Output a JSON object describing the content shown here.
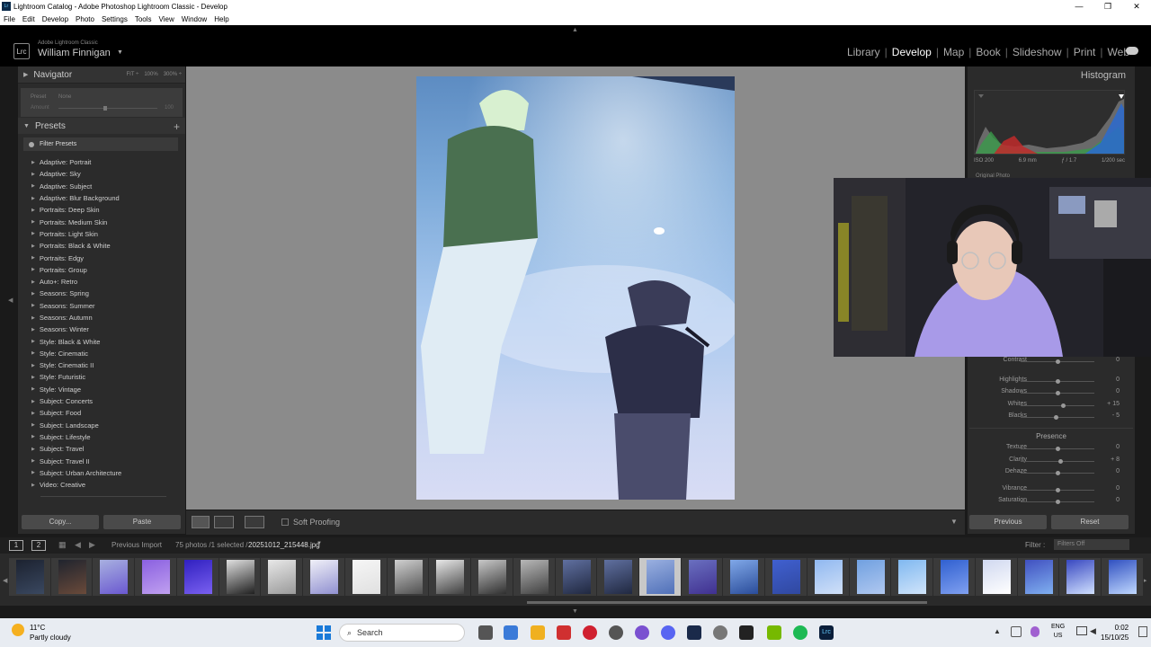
{
  "window": {
    "title": "Lightroom Catalog - Adobe Photoshop Lightroom Classic - Develop",
    "controls": [
      "—",
      "❐",
      "✕"
    ]
  },
  "menu": [
    "File",
    "Edit",
    "Develop",
    "Photo",
    "Settings",
    "Tools",
    "View",
    "Window",
    "Help"
  ],
  "identity": {
    "logo": "Lrc",
    "app_name": "Adobe Lightroom Classic",
    "user": "William Finnigan"
  },
  "modules": [
    "Library",
    "Develop",
    "Map",
    "Book",
    "Slideshow",
    "Print",
    "Web"
  ],
  "active_module": "Develop",
  "navigator": {
    "title": "Navigator",
    "zoom_options": [
      "FIT ÷",
      "100%",
      "300% ÷"
    ],
    "preset_label": "Preset",
    "preset_value": "None",
    "amount_label": "Amount",
    "amount_value": "100"
  },
  "presets": {
    "title": "Presets",
    "filter_label": "Filter Presets",
    "items": [
      "Adaptive: Portrait",
      "Adaptive: Sky",
      "Adaptive: Subject",
      "Adaptive: Blur Background",
      "Portraits: Deep Skin",
      "Portraits: Medium Skin",
      "Portraits: Light Skin",
      "Portraits: Black & White",
      "Portraits: Edgy",
      "Portraits: Group",
      "Auto+: Retro",
      "Seasons: Spring",
      "Seasons: Summer",
      "Seasons: Autumn",
      "Seasons: Winter",
      "Style: Black & White",
      "Style: Cinematic",
      "Style: Cinematic II",
      "Style: Futuristic",
      "Style: Vintage",
      "Subject: Concerts",
      "Subject: Food",
      "Subject: Landscape",
      "Subject: Lifestyle",
      "Subject: Travel",
      "Subject: Travel II",
      "Subject: Urban Architecture",
      "Video: Creative"
    ]
  },
  "left_buttons": {
    "copy": "Copy...",
    "paste": "Paste"
  },
  "toolbar": {
    "soft_proofing": "Soft Proofing"
  },
  "histogram": {
    "title": "Histogram",
    "iso": "ISO 200",
    "focal": "6.9 mm",
    "aperture": "ƒ / 1.7",
    "shutter": "1/200 sec",
    "original_photo": "Original Photo"
  },
  "tone": [
    {
      "label": "Contrast",
      "value": "0",
      "pos": 0.5
    },
    {
      "label": "Highlights",
      "value": "0",
      "pos": 0.5
    },
    {
      "label": "Shadows",
      "value": "0",
      "pos": 0.5
    },
    {
      "label": "Whites",
      "value": "+ 15",
      "pos": 0.575
    },
    {
      "label": "Blacks",
      "value": "- 5",
      "pos": 0.475
    }
  ],
  "presence": {
    "title": "Presence",
    "sliders": [
      {
        "label": "Texture",
        "value": "0",
        "pos": 0.5
      },
      {
        "label": "Clarity",
        "value": "+ 8",
        "pos": 0.54
      },
      {
        "label": "Dehaze",
        "value": "0",
        "pos": 0.5
      },
      {
        "label": "Vibrance",
        "value": "0",
        "pos": 0.5
      },
      {
        "label": "Saturation",
        "value": "0",
        "pos": 0.5
      }
    ]
  },
  "right_buttons": {
    "previous": "Previous",
    "reset": "Reset"
  },
  "filmbar": {
    "screen1": "1",
    "screen2": "2",
    "source": "Previous Import",
    "count": "75 photos /1 selected /",
    "filename": "20251012_215448.jpg",
    "filter_label": "Filter :",
    "filter_value": "Filters Off"
  },
  "film_thumbs": [
    {
      "c1": "#1c2230",
      "c2": "#3a4860"
    },
    {
      "c1": "#20242e",
      "c2": "#6a4a3a"
    },
    {
      "c1": "#a8b0e0",
      "c2": "#6a58d0"
    },
    {
      "c1": "#8a60e0",
      "c2": "#c0a0f0"
    },
    {
      "c1": "#3020c0",
      "c2": "#7a60f0"
    },
    {
      "c1": "#e0e0e0",
      "c2": "#202020"
    },
    {
      "c1": "#e8e8e8",
      "c2": "#9a9a9a"
    },
    {
      "c1": "#f0f0f8",
      "c2": "#9090d0"
    },
    {
      "c1": "#f6f6f6",
      "c2": "#e0e0e0"
    },
    {
      "c1": "#d0d0d0",
      "c2": "#505050"
    },
    {
      "c1": "#e8e8e8",
      "c2": "#404040"
    },
    {
      "c1": "#c8c8c8",
      "c2": "#303030"
    },
    {
      "c1": "#b8b8b8",
      "c2": "#404040"
    },
    {
      "c1": "#6070a0",
      "c2": "#202840"
    },
    {
      "c1": "#6070a0",
      "c2": "#202840"
    },
    {
      "c1": "#9ab0e0",
      "c2": "#5070b8"
    },
    {
      "c1": "#6a70c0",
      "c2": "#403090"
    },
    {
      "c1": "#80a8e8",
      "c2": "#2a4c9a"
    },
    {
      "c1": "#4060d0",
      "c2": "#3048a0"
    },
    {
      "c1": "#90b8f0",
      "c2": "#d0e0f8"
    },
    {
      "c1": "#70a0e0",
      "c2": "#b0c8f0"
    },
    {
      "c1": "#80b8f0",
      "c2": "#d0e4fa"
    },
    {
      "c1": "#3060d0",
      "c2": "#80a0f0"
    },
    {
      "c1": "#d0d8f0",
      "c2": "#ffffff"
    },
    {
      "c1": "#4050c0",
      "c2": "#80b0f0"
    },
    {
      "c1": "#3848c0",
      "c2": "#d0e0ff"
    },
    {
      "c1": "#3050c0",
      "c2": "#c0d8ff"
    }
  ],
  "taskbar": {
    "temp": "11°C",
    "weather": "Partly cloudy",
    "search": "Search",
    "lang1": "ENG",
    "lang2": "US",
    "time": "0:02",
    "date": "15/10/25"
  }
}
